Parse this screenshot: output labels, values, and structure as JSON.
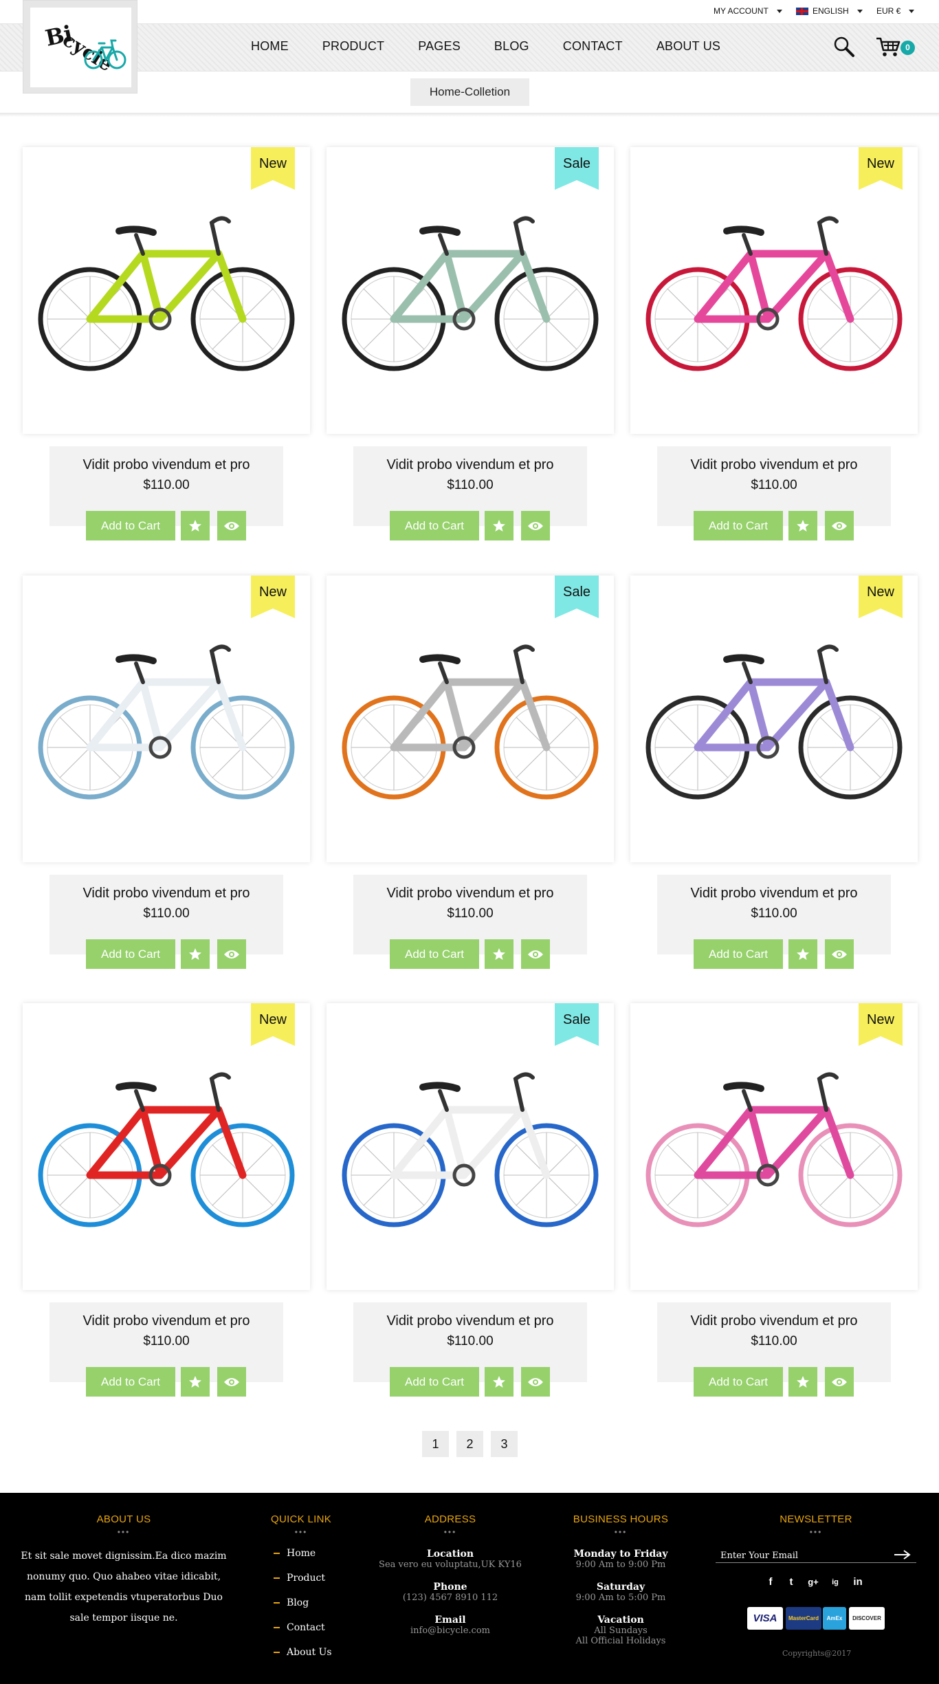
{
  "topbar": {
    "account": "MY ACCOUNT",
    "language": "ENGLISH",
    "currency": "EUR €"
  },
  "logo": {
    "part1": "Bi",
    "part2": "cycle"
  },
  "nav": [
    "HOME",
    "PRODUCT",
    "PAGES",
    "BLOG",
    "CONTACT",
    "ABOUT US"
  ],
  "cart_count": "0",
  "breadcrumb": "Home-Colletion",
  "products": [
    {
      "badge": "New",
      "name": "Vidit probo vivendum et pro",
      "price": "$110.00",
      "color": "#b5d91f",
      "rim": "#222222"
    },
    {
      "badge": "Sale",
      "name": "Vidit probo vivendum et pro",
      "price": "$110.00",
      "color": "#9bbfad",
      "rim": "#222222"
    },
    {
      "badge": "New",
      "name": "Vidit probo vivendum et pro",
      "price": "$110.00",
      "color": "#e5489b",
      "rim": "#c8183a"
    },
    {
      "badge": "New",
      "name": "Vidit probo vivendum et pro",
      "price": "$110.00",
      "color": "#e8eef2",
      "rim": "#7aaccb"
    },
    {
      "badge": "Sale",
      "name": "Vidit probo vivendum et pro",
      "price": "$110.00",
      "color": "#b9b9b9",
      "rim": "#e0731c"
    },
    {
      "badge": "New",
      "name": "Vidit probo vivendum et pro",
      "price": "$110.00",
      "color": "#9c8ad6",
      "rim": "#2a2a2a"
    },
    {
      "badge": "New",
      "name": "Vidit probo vivendum et pro",
      "price": "$110.00",
      "color": "#e02424",
      "rim": "#1e8ed8"
    },
    {
      "badge": "Sale",
      "name": "Vidit probo vivendum et pro",
      "price": "$110.00",
      "color": "#eeeeee",
      "rim": "#2767c9"
    },
    {
      "badge": "New",
      "name": "Vidit probo vivendum et pro",
      "price": "$110.00",
      "color": "#e04a9e",
      "rim": "#e890b8"
    }
  ],
  "buttons": {
    "add_to_cart": "Add to Cart"
  },
  "colors": {
    "new_badge": "#f6ef5b",
    "sale_badge": "#7fe8e4",
    "button": "#96d16b",
    "accent": "#e9a60e",
    "teal": "#17a8a8"
  },
  "pagination": [
    "1",
    "2",
    "3"
  ],
  "footer": {
    "about": {
      "heading": "ABOUT US",
      "text": "Et sit sale movet dignissim.Ea dico mazim nonumy quo. Quo ahabeo vitae idicabit, nam tollit expetendis vtuperatorbus Duo sale tempor iisque ne."
    },
    "quick": {
      "heading": "QUICK LINK",
      "links": [
        "Home",
        "Product",
        "Blog",
        "Contact",
        "About Us"
      ]
    },
    "address": {
      "heading": "ADDRESS",
      "location_label": "Location",
      "location": "Sea vero eu voluptatu,UK KY16",
      "phone_label": "Phone",
      "phone": "(123) 4567 8910 112",
      "email_label": "Email",
      "email": "info@bicycle.com"
    },
    "hours": {
      "heading": "BUSINESS HOURS",
      "weekday_label": "Monday to Friday",
      "weekday": "9:00 Am to 9:00 Pm",
      "saturday_label": "Saturday",
      "saturday": "9:00 Am to 5:00 Pm",
      "vacation_label": "Vacation",
      "vacation1": "All Sundays",
      "vacation2": "All Official Holidays"
    },
    "newsletter": {
      "heading": "NEWSLETTER",
      "placeholder": "Enter Your Email"
    },
    "social": [
      "f",
      "t",
      "g+",
      "ig",
      "in"
    ],
    "payments": [
      "VISA",
      "MasterCard",
      "AmEx",
      "DISCOVER"
    ],
    "copyright": "Copyrights@2017"
  }
}
